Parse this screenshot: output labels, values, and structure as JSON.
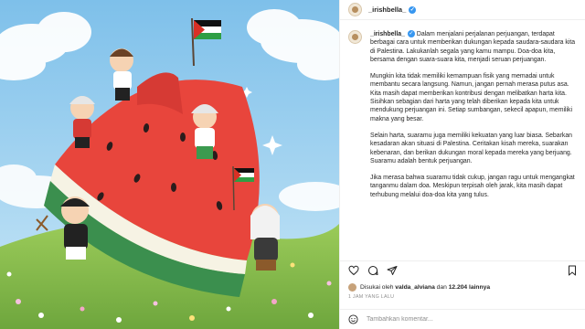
{
  "post": {
    "username": "_irishbella_",
    "verified_mark": "✓",
    "caption_paragraphs": [
      "Dalam menjalani perjalanan perjuangan, terdapat berbagai cara untuk memberikan dukungan kepada saudara-saudara kita di Palestina. Lakukanlah segala yang kamu mampu. Doa-doa kita, bersama dengan suara-suara kita, menjadi seruan perjuangan.",
      "Mungkin kita tidak memiliki kemampuan fisik yang memadai untuk membantu secara langsung. Namun, jangan pernah merasa putus asa. Kita masih dapat memberikan kontribusi dengan melibatkan harta kita. Sisihkan sebagian dari harta yang telah diberikan kepada kita untuk mendukung perjuangan ini. Setiap sumbangan, sekecil apapun, memiliki makna yang besar.",
      "Selain harta, suaramu juga memiliki kekuatan yang luar biasa. Sebarkan kesadaran akan situasi di Palestina. Ceritakan kisah mereka, suarakan kebenaran, dan berikan dukungan moral kepada mereka yang berjuang. Suaramu adalah bentuk perjuangan.",
      "Jika merasa bahwa suaramu tidak cukup, jangan ragu untuk mengangkat tanganmu dalam doa. Meskipun terpisah oleh jarak, kita masih dapat terhubung melalui doa-doa kita yang tulus."
    ],
    "liked_prefix": "Disukai oleh",
    "liked_user": "valda_alviana",
    "liked_mid": "dan",
    "liked_count": "12.204 lainnya",
    "timestamp": "1 JAM YANG LALU",
    "comment_placeholder": "Tambahkan komentar..."
  },
  "icons": {
    "like": "heart-icon",
    "comment": "comment-icon",
    "share": "paper-plane-icon",
    "save": "bookmark-icon",
    "emoji": "smiley-icon"
  },
  "colors": {
    "watermelon_red": "#e8453c",
    "rind_green": "#3b8f4e",
    "sky_blue": "#8fc9ea",
    "grass": "#8cc152",
    "verified_blue": "#3897f0"
  }
}
